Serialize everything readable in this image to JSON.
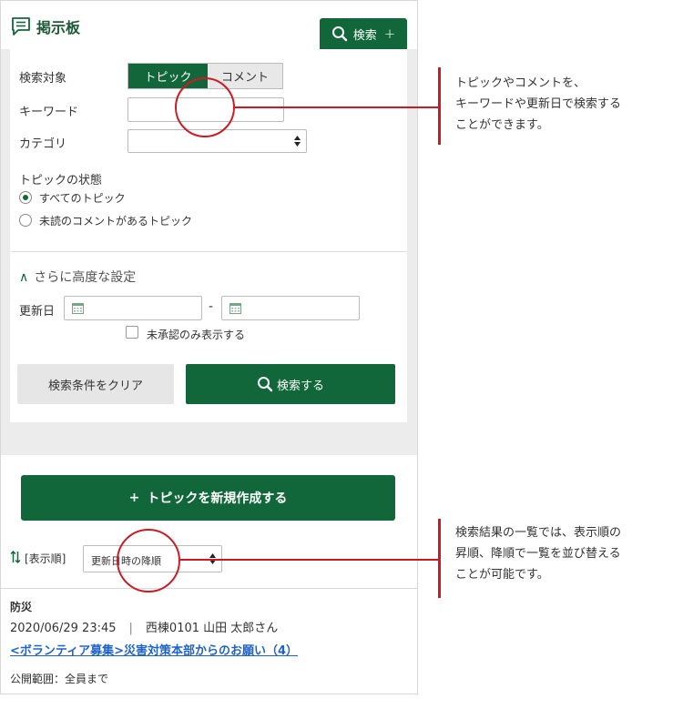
{
  "header": {
    "title": "掲示板",
    "search_toggle_label": "検索"
  },
  "search": {
    "target_label": "検索対象",
    "target_options": [
      "トピック",
      "コメント"
    ],
    "keyword_label": "キーワード",
    "keyword_value": "",
    "category_label": "カテゴリ",
    "category_value": "",
    "status_heading": "トピックの状態",
    "status_options": [
      "すべてのトピック",
      "未読のコメントがあるトピック"
    ],
    "advanced_label": "さらに高度な設定",
    "updated_label": "更新日",
    "date_separator": "-",
    "unapproved_label": "未承認のみ表示する",
    "clear_button": "検索条件をクリア",
    "search_button": "検索する"
  },
  "new_topic_button": "トピックを新規作成する",
  "sort": {
    "label": "[表示順]",
    "value": "更新日時の降順"
  },
  "topics": [
    {
      "category": "防災",
      "datetime": "2020/06/29 23:45",
      "separator": "|",
      "author": "西棟0101 山田 太郎さん",
      "title": "<ボランティア募集>災害対策本部からのお願い（4）",
      "scope": "公開範囲：全員まで"
    }
  ],
  "annotations": [
    {
      "lines": [
        "トピックやコメントを、",
        "キーワードや更新日で検索する",
        "ことができます。"
      ]
    },
    {
      "lines": [
        "検索結果の一覧では、表示順の",
        "昇順、降順で一覧を並び替える",
        "ことが可能です。"
      ]
    }
  ],
  "colors": {
    "brand_green": "#11673a",
    "callout_red": "#cc1a24",
    "link_blue": "#1e64c8"
  }
}
